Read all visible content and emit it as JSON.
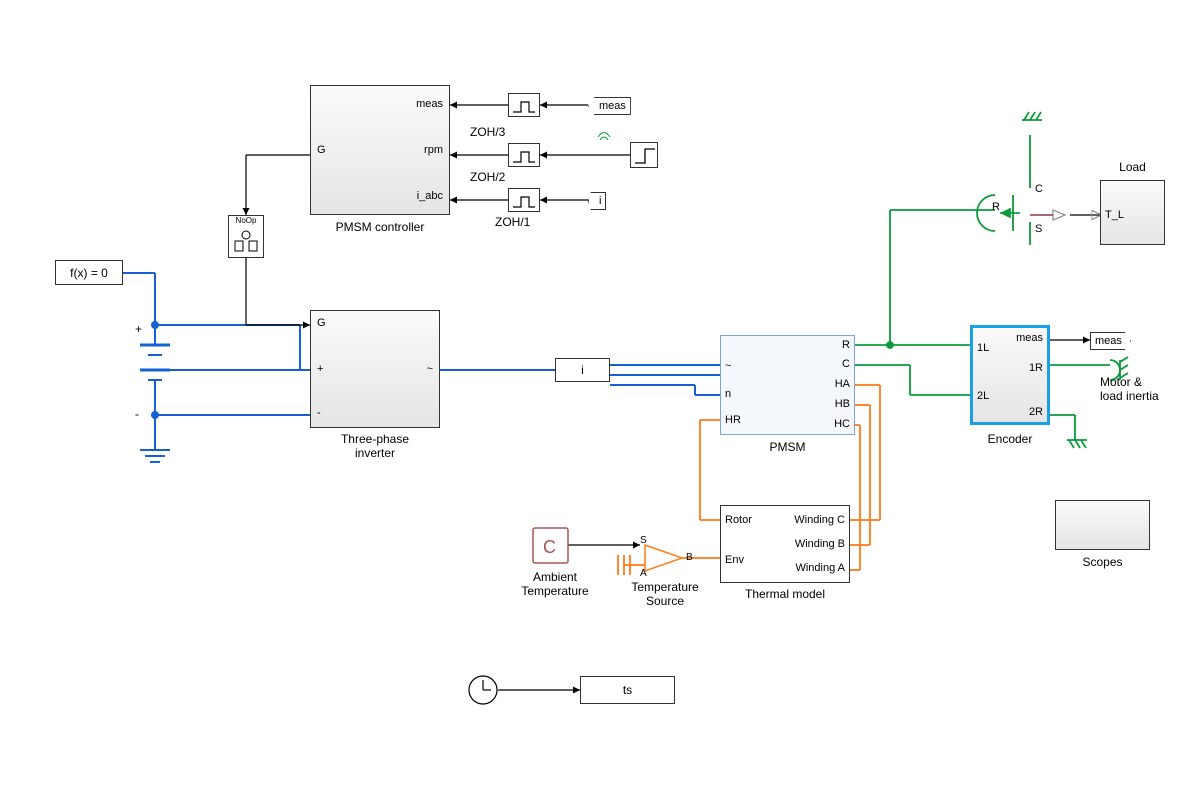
{
  "blocks": {
    "solver": {
      "text": "f(x) = 0"
    },
    "controller": {
      "title": "PMSM controller",
      "ports": {
        "g": "G",
        "meas": "meas",
        "rpm": "rpm",
        "iabc": "i_abc"
      },
      "zoh_labels": {
        "z1": "ZOH/1",
        "z2": "ZOH/2",
        "z3": "ZOH/3"
      }
    },
    "inverter": {
      "title": "Three-phase\ninverter",
      "ports": {
        "g": "G",
        "plus": "+",
        "minus": "-",
        "ac": "~"
      }
    },
    "current_sensor": {
      "text": "i"
    },
    "pmsm": {
      "title": "PMSM",
      "ports": {
        "tilde": "~",
        "n": "n",
        "hr": "HR",
        "r": "R",
        "c": "C",
        "ha": "HA",
        "hb": "HB",
        "hc": "HC"
      }
    },
    "thermal": {
      "title": "Thermal model",
      "ports": {
        "rotor": "Rotor",
        "env": "Env",
        "wa": "Winding A",
        "wb": "Winding B",
        "wc": "Winding C"
      }
    },
    "ambient": {
      "title": "Ambient\nTemperature",
      "symbol": "C"
    },
    "tempsrc": {
      "title": "Temperature\nSource",
      "ports": {
        "s": "S",
        "a": "A",
        "b": "B"
      }
    },
    "encoder": {
      "title": "Encoder",
      "ports": {
        "l1": "1L",
        "l2": "2L",
        "r1": "1R",
        "r2": "2R",
        "meas": "meas"
      }
    },
    "load": {
      "title": "Load",
      "port": "T_L",
      "rcs": {
        "r": "R",
        "c": "C",
        "s": "S"
      }
    },
    "motor_inertia": {
      "title": "Motor &\nload inertia"
    },
    "scopes": {
      "title": "Scopes"
    },
    "clock_out": {
      "text": "ts"
    },
    "tags": {
      "meas": "meas",
      "i": "i"
    },
    "gate_label": "NoOp"
  }
}
